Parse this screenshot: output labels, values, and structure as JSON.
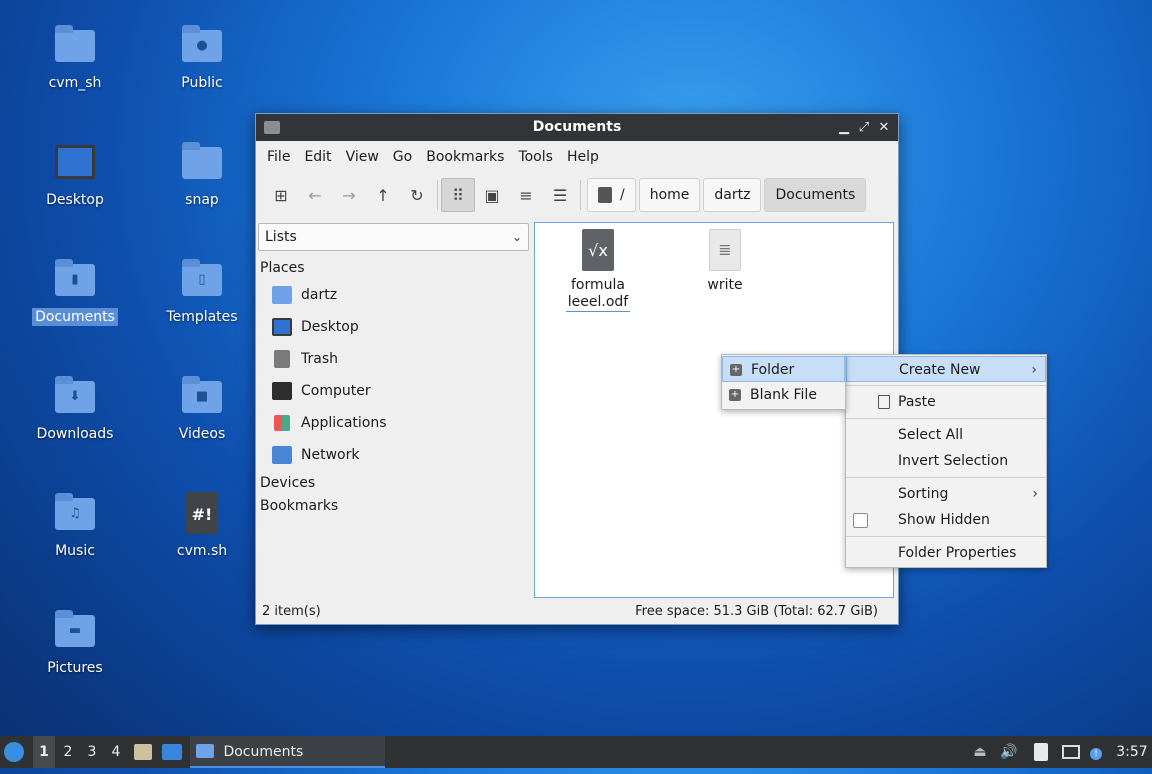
{
  "desktop": {
    "icons": [
      {
        "label": "cvm_sh",
        "icon": "folder-icon"
      },
      {
        "label": "Public",
        "icon": "public-folder-icon"
      },
      {
        "label": "Desktop",
        "icon": "desktop-icon"
      },
      {
        "label": "snap",
        "icon": "folder-icon"
      },
      {
        "label": "Documents",
        "icon": "documents-folder-icon"
      },
      {
        "label": "Templates",
        "icon": "templates-folder-icon"
      },
      {
        "label": "Downloads",
        "icon": "downloads-folder-icon"
      },
      {
        "label": "Videos",
        "icon": "videos-folder-icon"
      },
      {
        "label": "Music",
        "icon": "music-folder-icon"
      },
      {
        "label": "cvm.sh",
        "icon": "script-file-icon"
      },
      {
        "label": "Pictures",
        "icon": "pictures-folder-icon"
      }
    ]
  },
  "window": {
    "title": "Documents",
    "menu": [
      "File",
      "Edit",
      "View",
      "Go",
      "Bookmarks",
      "Tools",
      "Help"
    ],
    "path": [
      "/",
      "home",
      "dartz",
      "Documents"
    ],
    "sidebar": {
      "mode": "Lists",
      "places_header": "Places",
      "places": [
        "dartz",
        "Desktop",
        "Trash",
        "Computer",
        "Applications",
        "Network"
      ],
      "devices_header": "Devices",
      "bookmarks_header": "Bookmarks"
    },
    "files": [
      {
        "name_line1": "formula",
        "name_line2": "leeel.odf",
        "icon": "formula-file-icon"
      },
      {
        "name_line1": "write",
        "name_line2": "",
        "icon": "text-file-icon"
      }
    ],
    "status": {
      "items": "2 item(s)",
      "free": "Free space: 51.3 GiB (Total: 62.7 GiB)"
    }
  },
  "context_menu": {
    "create_new": "Create New",
    "paste": "Paste",
    "select_all": "Select All",
    "invert_selection": "Invert Selection",
    "sorting": "Sorting",
    "show_hidden": "Show Hidden",
    "folder_properties": "Folder Properties"
  },
  "submenu": {
    "folder": "Folder",
    "blank_file": "Blank File"
  },
  "taskbar": {
    "workspaces": [
      "1",
      "2",
      "3",
      "4"
    ],
    "task_label": "Documents",
    "clock": "3:57"
  },
  "colors": {
    "accent": "#5a8fd8",
    "menu_highlight": "#c7def6",
    "titlebar": "#323437"
  }
}
